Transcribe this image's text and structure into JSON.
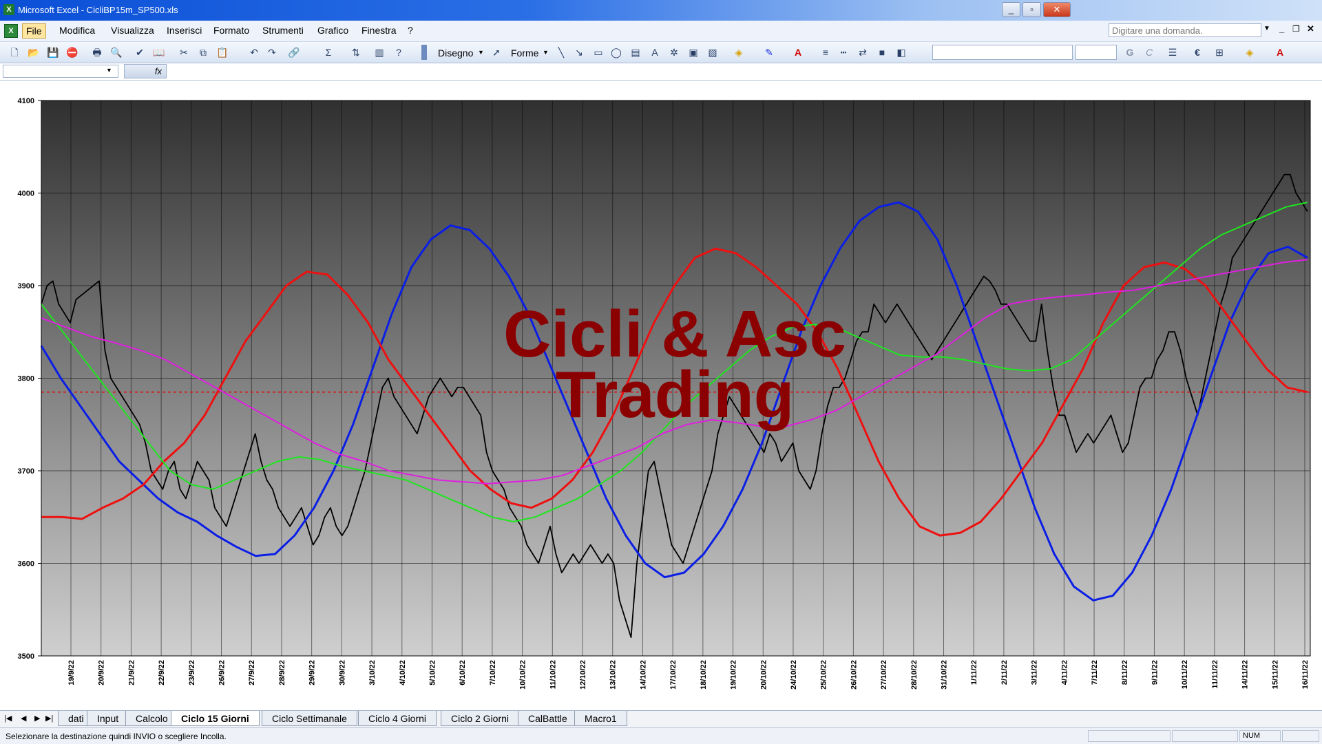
{
  "window": {
    "title": "Microsoft Excel - CicliBP15m_SP500.xls"
  },
  "menu": [
    "File",
    "Modifica",
    "Visualizza",
    "Inserisci",
    "Formato",
    "Strumenti",
    "Grafico",
    "Finestra",
    "?"
  ],
  "help_box": {
    "placeholder": "Digitare una domanda."
  },
  "toolbar": {
    "disegno": "Disegno",
    "forme": "Forme"
  },
  "sheet_tabs": [
    "dati",
    "Input",
    "Calcolo",
    "Ciclo 15 Giorni",
    "Ciclo Settimanale",
    "Ciclo 4 Giorni",
    "Ciclo 2 Giorni",
    "CalBattle",
    "Macro1"
  ],
  "active_tab": "Ciclo 15 Giorni",
  "status": {
    "message": "Selezionare la destinazione quindi INVIO o scegliere Incolla.",
    "num": "NUM"
  },
  "chart_data": {
    "type": "line",
    "watermark": [
      "Cicli & Asc",
      "Trading"
    ],
    "ylim": [
      3500,
      4100
    ],
    "yticks": [
      "4100",
      "4000",
      "3900",
      "3800",
      "3700",
      "3600",
      "3500"
    ],
    "x_tick_labels": [
      "19/9/22",
      "20/9/22",
      "21/9/22",
      "22/9/22",
      "23/9/22",
      "26/9/22",
      "27/9/22",
      "28/9/22",
      "29/9/22",
      "30/9/22",
      "3/10/22",
      "4/10/22",
      "5/10/22",
      "6/10/22",
      "7/10/22",
      "10/10/22",
      "11/10/22",
      "12/10/22",
      "13/10/22",
      "14/10/22",
      "17/10/22",
      "18/10/22",
      "19/10/22",
      "20/10/22",
      "24/10/22",
      "25/10/22",
      "26/10/22",
      "27/10/22",
      "28/10/22",
      "31/10/22",
      "1/11/22",
      "2/11/22",
      "3/11/22",
      "4/11/22",
      "7/11/22",
      "8/11/22",
      "9/11/22",
      "10/11/22",
      "11/11/22",
      "14/11/22",
      "15/11/22",
      "16/11/22"
    ],
    "reference_line": 3785,
    "colors": {
      "price": "#000000",
      "blue": "#0a1ee6",
      "red": "#ee1010",
      "green": "#1ee61e",
      "magenta": "#e01ee0",
      "dotted": "#2828d2",
      "ref": "#dd1111"
    },
    "series": [
      {
        "values": [
          3880,
          3900,
          3905,
          3880,
          3870,
          3860,
          3885,
          3890,
          3895,
          3900,
          3905,
          3830,
          3800,
          3790,
          3780,
          3770,
          3760,
          3750,
          3730,
          3700,
          3690,
          3680,
          3700,
          3710,
          3680,
          3670,
          3690,
          3710,
          3700,
          3690,
          3660,
          3650,
          3640,
          3660,
          3680,
          3700,
          3720,
          3740,
          3710,
          3690,
          3680,
          3660,
          3650,
          3640,
          3650,
          3660,
          3640,
          3620,
          3630,
          3650,
          3660,
          3640,
          3630,
          3640,
          3660,
          3680,
          3700,
          3730,
          3760,
          3790,
          3800,
          3780,
          3770,
          3760,
          3750,
          3740,
          3760,
          3780,
          3790,
          3800,
          3790,
          3780,
          3790,
          3790,
          3780,
          3770,
          3760,
          3720,
          3700,
          3690,
          3680,
          3660,
          3650,
          3640,
          3620,
          3610,
          3600,
          3620,
          3640,
          3610,
          3590,
          3600,
          3610,
          3600,
          3610,
          3620,
          3610,
          3600,
          3610,
          3600,
          3560,
          3540,
          3520,
          3600,
          3650,
          3700,
          3710,
          3680,
          3650,
          3620,
          3610,
          3600,
          3620,
          3640,
          3660,
          3680,
          3700,
          3740,
          3760,
          3780,
          3770,
          3760,
          3750,
          3740,
          3730,
          3720,
          3740,
          3730,
          3710,
          3720,
          3730,
          3700,
          3690,
          3680,
          3700,
          3740,
          3770,
          3790,
          3790,
          3800,
          3820,
          3840,
          3850,
          3850,
          3880,
          3870,
          3860,
          3870,
          3880,
          3870,
          3860,
          3850,
          3840,
          3830,
          3820,
          3830,
          3840,
          3850,
          3860,
          3870,
          3880,
          3890,
          3900,
          3910,
          3905,
          3895,
          3880,
          3880,
          3870,
          3860,
          3850,
          3840,
          3840,
          3880,
          3830,
          3790,
          3760,
          3760,
          3740,
          3720,
          3730,
          3740,
          3730,
          3740,
          3750,
          3760,
          3740,
          3720,
          3730,
          3760,
          3790,
          3800,
          3800,
          3820,
          3830,
          3850,
          3850,
          3830,
          3800,
          3780,
          3760,
          3790,
          3820,
          3850,
          3880,
          3900,
          3930,
          3940,
          3950,
          3960,
          3970,
          3980,
          3990,
          4000,
          4010,
          4020,
          4020,
          4000,
          3990,
          3980
        ]
      },
      {
        "values": [
          3835,
          3800,
          3770,
          3740,
          3710,
          3690,
          3670,
          3655,
          3645,
          3630,
          3618,
          3608,
          3610,
          3630,
          3660,
          3700,
          3750,
          3810,
          3870,
          3920,
          3950,
          3965,
          3960,
          3940,
          3910,
          3870,
          3820,
          3770,
          3720,
          3670,
          3630,
          3600,
          3585,
          3590,
          3610,
          3640,
          3680,
          3730,
          3790,
          3850,
          3900,
          3940,
          3970,
          3985,
          3990,
          3980,
          3950,
          3900,
          3840,
          3780,
          3720,
          3660,
          3610,
          3575,
          3560,
          3565,
          3590,
          3630,
          3680,
          3740,
          3800,
          3860,
          3905,
          3935,
          3942,
          3930
        ]
      },
      {
        "values": [
          3650,
          3650,
          3648,
          3660,
          3670,
          3685,
          3710,
          3730,
          3760,
          3800,
          3840,
          3870,
          3900,
          3915,
          3912,
          3890,
          3860,
          3820,
          3790,
          3760,
          3730,
          3700,
          3680,
          3665,
          3660,
          3670,
          3690,
          3720,
          3760,
          3810,
          3860,
          3900,
          3930,
          3940,
          3935,
          3920,
          3900,
          3880,
          3850,
          3810,
          3760,
          3710,
          3670,
          3640,
          3630,
          3633,
          3645,
          3670,
          3700,
          3730,
          3770,
          3810,
          3860,
          3900,
          3920,
          3925,
          3918,
          3900,
          3870,
          3840,
          3810,
          3790,
          3785
        ]
      },
      {
        "values": [
          3880,
          3850,
          3820,
          3790,
          3760,
          3730,
          3700,
          3685,
          3680,
          3690,
          3700,
          3710,
          3715,
          3712,
          3705,
          3700,
          3695,
          3690,
          3680,
          3670,
          3660,
          3650,
          3645,
          3650,
          3660,
          3670,
          3685,
          3700,
          3720,
          3745,
          3770,
          3790,
          3810,
          3830,
          3845,
          3855,
          3858,
          3855,
          3845,
          3835,
          3825,
          3823,
          3823,
          3820,
          3815,
          3810,
          3808,
          3810,
          3820,
          3840,
          3860,
          3880,
          3900,
          3920,
          3940,
          3955,
          3965,
          3975,
          3985,
          3990
        ]
      },
      {
        "values": [
          3865,
          3855,
          3845,
          3838,
          3830,
          3820,
          3805,
          3790,
          3775,
          3760,
          3745,
          3730,
          3718,
          3710,
          3700,
          3695,
          3690,
          3688,
          3686,
          3688,
          3690,
          3695,
          3705,
          3715,
          3725,
          3740,
          3750,
          3755,
          3752,
          3748,
          3748,
          3755,
          3765,
          3780,
          3795,
          3810,
          3825,
          3845,
          3865,
          3880,
          3885,
          3888,
          3890,
          3893,
          3895,
          3900,
          3905,
          3910,
          3915,
          3920,
          3925,
          3928
        ]
      }
    ]
  }
}
